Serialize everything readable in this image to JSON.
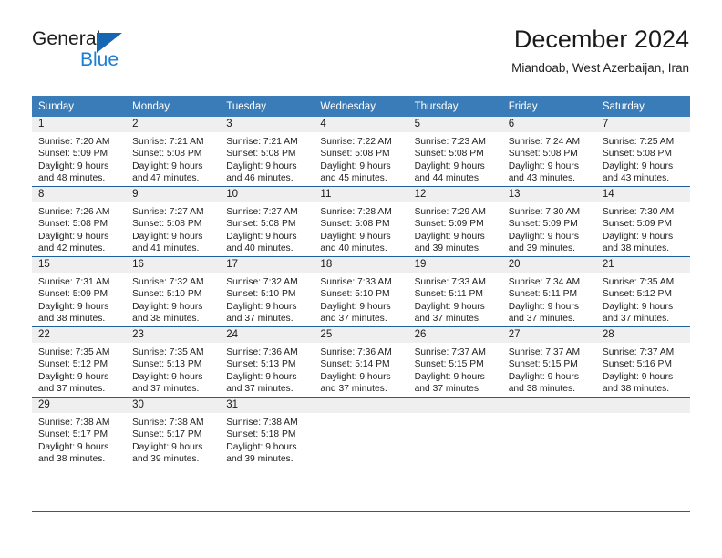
{
  "brand": {
    "name_top": "General",
    "name_bottom": "Blue",
    "triangle_color": "#1567b2",
    "blue_color": "#1b7fd4"
  },
  "header": {
    "title": "December 2024",
    "subtitle": "Miandoab, West Azerbaijan, Iran"
  },
  "theme": {
    "header_bg": "#3a7cb8",
    "rule_color": "#1f5fa0",
    "daynum_bg": "#efefef"
  },
  "calendar": {
    "weekday_headers": [
      "Sunday",
      "Monday",
      "Tuesday",
      "Wednesday",
      "Thursday",
      "Friday",
      "Saturday"
    ],
    "weeks": [
      [
        {
          "day": "1",
          "sunrise": "Sunrise: 7:20 AM",
          "sunset": "Sunset: 5:09 PM",
          "daylight1": "Daylight: 9 hours",
          "daylight2": "and 48 minutes."
        },
        {
          "day": "2",
          "sunrise": "Sunrise: 7:21 AM",
          "sunset": "Sunset: 5:08 PM",
          "daylight1": "Daylight: 9 hours",
          "daylight2": "and 47 minutes."
        },
        {
          "day": "3",
          "sunrise": "Sunrise: 7:21 AM",
          "sunset": "Sunset: 5:08 PM",
          "daylight1": "Daylight: 9 hours",
          "daylight2": "and 46 minutes."
        },
        {
          "day": "4",
          "sunrise": "Sunrise: 7:22 AM",
          "sunset": "Sunset: 5:08 PM",
          "daylight1": "Daylight: 9 hours",
          "daylight2": "and 45 minutes."
        },
        {
          "day": "5",
          "sunrise": "Sunrise: 7:23 AM",
          "sunset": "Sunset: 5:08 PM",
          "daylight1": "Daylight: 9 hours",
          "daylight2": "and 44 minutes."
        },
        {
          "day": "6",
          "sunrise": "Sunrise: 7:24 AM",
          "sunset": "Sunset: 5:08 PM",
          "daylight1": "Daylight: 9 hours",
          "daylight2": "and 43 minutes."
        },
        {
          "day": "7",
          "sunrise": "Sunrise: 7:25 AM",
          "sunset": "Sunset: 5:08 PM",
          "daylight1": "Daylight: 9 hours",
          "daylight2": "and 43 minutes."
        }
      ],
      [
        {
          "day": "8",
          "sunrise": "Sunrise: 7:26 AM",
          "sunset": "Sunset: 5:08 PM",
          "daylight1": "Daylight: 9 hours",
          "daylight2": "and 42 minutes."
        },
        {
          "day": "9",
          "sunrise": "Sunrise: 7:27 AM",
          "sunset": "Sunset: 5:08 PM",
          "daylight1": "Daylight: 9 hours",
          "daylight2": "and 41 minutes."
        },
        {
          "day": "10",
          "sunrise": "Sunrise: 7:27 AM",
          "sunset": "Sunset: 5:08 PM",
          "daylight1": "Daylight: 9 hours",
          "daylight2": "and 40 minutes."
        },
        {
          "day": "11",
          "sunrise": "Sunrise: 7:28 AM",
          "sunset": "Sunset: 5:08 PM",
          "daylight1": "Daylight: 9 hours",
          "daylight2": "and 40 minutes."
        },
        {
          "day": "12",
          "sunrise": "Sunrise: 7:29 AM",
          "sunset": "Sunset: 5:09 PM",
          "daylight1": "Daylight: 9 hours",
          "daylight2": "and 39 minutes."
        },
        {
          "day": "13",
          "sunrise": "Sunrise: 7:30 AM",
          "sunset": "Sunset: 5:09 PM",
          "daylight1": "Daylight: 9 hours",
          "daylight2": "and 39 minutes."
        },
        {
          "day": "14",
          "sunrise": "Sunrise: 7:30 AM",
          "sunset": "Sunset: 5:09 PM",
          "daylight1": "Daylight: 9 hours",
          "daylight2": "and 38 minutes."
        }
      ],
      [
        {
          "day": "15",
          "sunrise": "Sunrise: 7:31 AM",
          "sunset": "Sunset: 5:09 PM",
          "daylight1": "Daylight: 9 hours",
          "daylight2": "and 38 minutes."
        },
        {
          "day": "16",
          "sunrise": "Sunrise: 7:32 AM",
          "sunset": "Sunset: 5:10 PM",
          "daylight1": "Daylight: 9 hours",
          "daylight2": "and 38 minutes."
        },
        {
          "day": "17",
          "sunrise": "Sunrise: 7:32 AM",
          "sunset": "Sunset: 5:10 PM",
          "daylight1": "Daylight: 9 hours",
          "daylight2": "and 37 minutes."
        },
        {
          "day": "18",
          "sunrise": "Sunrise: 7:33 AM",
          "sunset": "Sunset: 5:10 PM",
          "daylight1": "Daylight: 9 hours",
          "daylight2": "and 37 minutes."
        },
        {
          "day": "19",
          "sunrise": "Sunrise: 7:33 AM",
          "sunset": "Sunset: 5:11 PM",
          "daylight1": "Daylight: 9 hours",
          "daylight2": "and 37 minutes."
        },
        {
          "day": "20",
          "sunrise": "Sunrise: 7:34 AM",
          "sunset": "Sunset: 5:11 PM",
          "daylight1": "Daylight: 9 hours",
          "daylight2": "and 37 minutes."
        },
        {
          "day": "21",
          "sunrise": "Sunrise: 7:35 AM",
          "sunset": "Sunset: 5:12 PM",
          "daylight1": "Daylight: 9 hours",
          "daylight2": "and 37 minutes."
        }
      ],
      [
        {
          "day": "22",
          "sunrise": "Sunrise: 7:35 AM",
          "sunset": "Sunset: 5:12 PM",
          "daylight1": "Daylight: 9 hours",
          "daylight2": "and 37 minutes."
        },
        {
          "day": "23",
          "sunrise": "Sunrise: 7:35 AM",
          "sunset": "Sunset: 5:13 PM",
          "daylight1": "Daylight: 9 hours",
          "daylight2": "and 37 minutes."
        },
        {
          "day": "24",
          "sunrise": "Sunrise: 7:36 AM",
          "sunset": "Sunset: 5:13 PM",
          "daylight1": "Daylight: 9 hours",
          "daylight2": "and 37 minutes."
        },
        {
          "day": "25",
          "sunrise": "Sunrise: 7:36 AM",
          "sunset": "Sunset: 5:14 PM",
          "daylight1": "Daylight: 9 hours",
          "daylight2": "and 37 minutes."
        },
        {
          "day": "26",
          "sunrise": "Sunrise: 7:37 AM",
          "sunset": "Sunset: 5:15 PM",
          "daylight1": "Daylight: 9 hours",
          "daylight2": "and 37 minutes."
        },
        {
          "day": "27",
          "sunrise": "Sunrise: 7:37 AM",
          "sunset": "Sunset: 5:15 PM",
          "daylight1": "Daylight: 9 hours",
          "daylight2": "and 38 minutes."
        },
        {
          "day": "28",
          "sunrise": "Sunrise: 7:37 AM",
          "sunset": "Sunset: 5:16 PM",
          "daylight1": "Daylight: 9 hours",
          "daylight2": "and 38 minutes."
        }
      ],
      [
        {
          "day": "29",
          "sunrise": "Sunrise: 7:38 AM",
          "sunset": "Sunset: 5:17 PM",
          "daylight1": "Daylight: 9 hours",
          "daylight2": "and 38 minutes."
        },
        {
          "day": "30",
          "sunrise": "Sunrise: 7:38 AM",
          "sunset": "Sunset: 5:17 PM",
          "daylight1": "Daylight: 9 hours",
          "daylight2": "and 39 minutes."
        },
        {
          "day": "31",
          "sunrise": "Sunrise: 7:38 AM",
          "sunset": "Sunset: 5:18 PM",
          "daylight1": "Daylight: 9 hours",
          "daylight2": "and 39 minutes."
        },
        {
          "day": "",
          "sunrise": "",
          "sunset": "",
          "daylight1": "",
          "daylight2": ""
        },
        {
          "day": "",
          "sunrise": "",
          "sunset": "",
          "daylight1": "",
          "daylight2": ""
        },
        {
          "day": "",
          "sunrise": "",
          "sunset": "",
          "daylight1": "",
          "daylight2": ""
        },
        {
          "day": "",
          "sunrise": "",
          "sunset": "",
          "daylight1": "",
          "daylight2": ""
        }
      ]
    ]
  }
}
